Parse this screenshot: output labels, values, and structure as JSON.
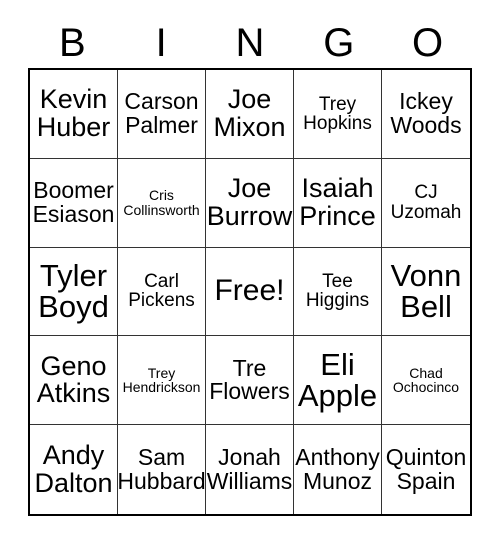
{
  "card": {
    "title": "BINGO",
    "header_letters": [
      "B",
      "I",
      "N",
      "G",
      "O"
    ],
    "free_space_label": "Free!",
    "colors": {
      "background": "#ffffff",
      "text": "#000000",
      "outer_border": "#000000",
      "inner_border": "#333333"
    },
    "grid": {
      "columns": 5,
      "rows": 5,
      "cells": [
        {
          "row": 1,
          "col": 1,
          "column_letter": "B",
          "text": "Kevin\nHuber",
          "size": "lg",
          "free": false
        },
        {
          "row": 1,
          "col": 2,
          "column_letter": "I",
          "text": "Carson\nPalmer",
          "size": "md",
          "free": false
        },
        {
          "row": 1,
          "col": 3,
          "column_letter": "N",
          "text": "Joe\nMixon",
          "size": "lg",
          "free": false
        },
        {
          "row": 1,
          "col": 4,
          "column_letter": "G",
          "text": "Trey\nHopkins",
          "size": "sm",
          "free": false
        },
        {
          "row": 1,
          "col": 5,
          "column_letter": "O",
          "text": "Ickey\nWoods",
          "size": "md",
          "free": false
        },
        {
          "row": 2,
          "col": 1,
          "column_letter": "B",
          "text": "Boomer\nEsiason",
          "size": "md",
          "free": false
        },
        {
          "row": 2,
          "col": 2,
          "column_letter": "I",
          "text": "Cris\nCollinsworth",
          "size": "xs",
          "free": false
        },
        {
          "row": 2,
          "col": 3,
          "column_letter": "N",
          "text": "Joe\nBurrow",
          "size": "lg",
          "free": false
        },
        {
          "row": 2,
          "col": 4,
          "column_letter": "G",
          "text": "Isaiah\nPrince",
          "size": "lg",
          "free": false
        },
        {
          "row": 2,
          "col": 5,
          "column_letter": "O",
          "text": "CJ\nUzomah",
          "size": "sm",
          "free": false
        },
        {
          "row": 3,
          "col": 1,
          "column_letter": "B",
          "text": "Tyler\nBoyd",
          "size": "xl",
          "free": false
        },
        {
          "row": 3,
          "col": 2,
          "column_letter": "I",
          "text": "Carl\nPickens",
          "size": "sm",
          "free": false
        },
        {
          "row": 3,
          "col": 3,
          "column_letter": "N",
          "text": "Free!",
          "size": "free",
          "free": true
        },
        {
          "row": 3,
          "col": 4,
          "column_letter": "G",
          "text": "Tee\nHiggins",
          "size": "sm",
          "free": false
        },
        {
          "row": 3,
          "col": 5,
          "column_letter": "O",
          "text": "Vonn\nBell",
          "size": "xl",
          "free": false
        },
        {
          "row": 4,
          "col": 1,
          "column_letter": "B",
          "text": "Geno\nAtkins",
          "size": "lg",
          "free": false
        },
        {
          "row": 4,
          "col": 2,
          "column_letter": "I",
          "text": "Trey\nHendrickson",
          "size": "xs",
          "free": false
        },
        {
          "row": 4,
          "col": 3,
          "column_letter": "N",
          "text": "Tre\nFlowers",
          "size": "md",
          "free": false
        },
        {
          "row": 4,
          "col": 4,
          "column_letter": "G",
          "text": "Eli\nApple",
          "size": "xl",
          "free": false
        },
        {
          "row": 4,
          "col": 5,
          "column_letter": "O",
          "text": "Chad\nOchocinco",
          "size": "xs",
          "free": false
        },
        {
          "row": 5,
          "col": 1,
          "column_letter": "B",
          "text": "Andy\nDalton",
          "size": "lg",
          "free": false
        },
        {
          "row": 5,
          "col": 2,
          "column_letter": "I",
          "text": "Sam\nHubbard",
          "size": "md",
          "free": false
        },
        {
          "row": 5,
          "col": 3,
          "column_letter": "N",
          "text": "Jonah\nWilliams",
          "size": "md",
          "free": false
        },
        {
          "row": 5,
          "col": 4,
          "column_letter": "G",
          "text": "Anthony\nMunoz",
          "size": "md",
          "free": false
        },
        {
          "row": 5,
          "col": 5,
          "column_letter": "O",
          "text": "Quinton\nSpain",
          "size": "md",
          "free": false
        }
      ]
    }
  }
}
